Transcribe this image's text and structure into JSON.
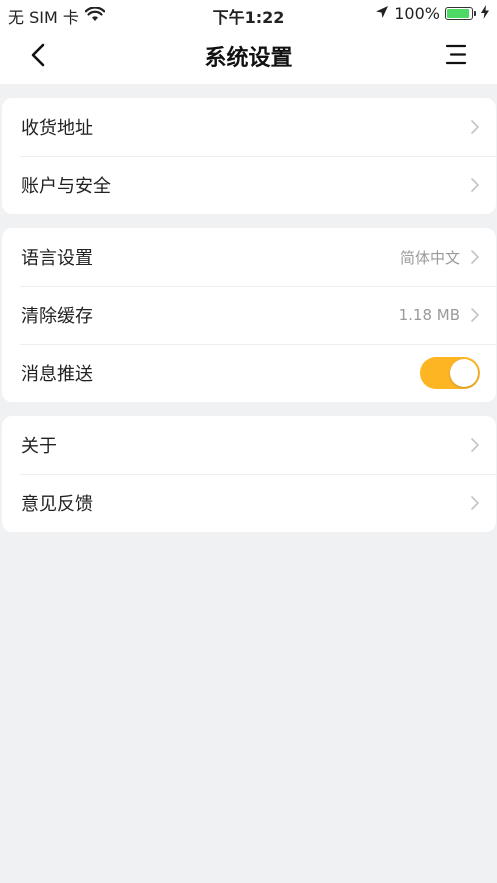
{
  "status_bar": {
    "carrier": "无 SIM 卡",
    "time": "下午1:22",
    "battery_percent": "100%",
    "battery_level": 1.0,
    "icons": [
      "wifi-icon",
      "location-arrow-icon",
      "battery-icon",
      "charging-bolt-icon"
    ]
  },
  "nav": {
    "title": "系统设置",
    "back_icon": "chevron-left-icon",
    "menu_icon": "menu-icon"
  },
  "groups": {
    "account": {
      "items": [
        {
          "label": "收货地址",
          "value": ""
        },
        {
          "label": "账户与安全",
          "value": ""
        }
      ]
    },
    "preferences": {
      "items": [
        {
          "label": "语言设置",
          "value": "简体中文"
        },
        {
          "label": "清除缓存",
          "value": "1.18 MB"
        },
        {
          "label": "消息推送",
          "value": "",
          "toggle_on": true
        }
      ]
    },
    "about": {
      "items": [
        {
          "label": "关于",
          "value": ""
        },
        {
          "label": "意见反馈",
          "value": ""
        }
      ]
    }
  },
  "colors": {
    "background": "#f0f1f3",
    "card": "#ffffff",
    "accent_toggle": "#fdb524",
    "secondary_text": "#9a9a9a",
    "battery_green": "#4cd964"
  }
}
